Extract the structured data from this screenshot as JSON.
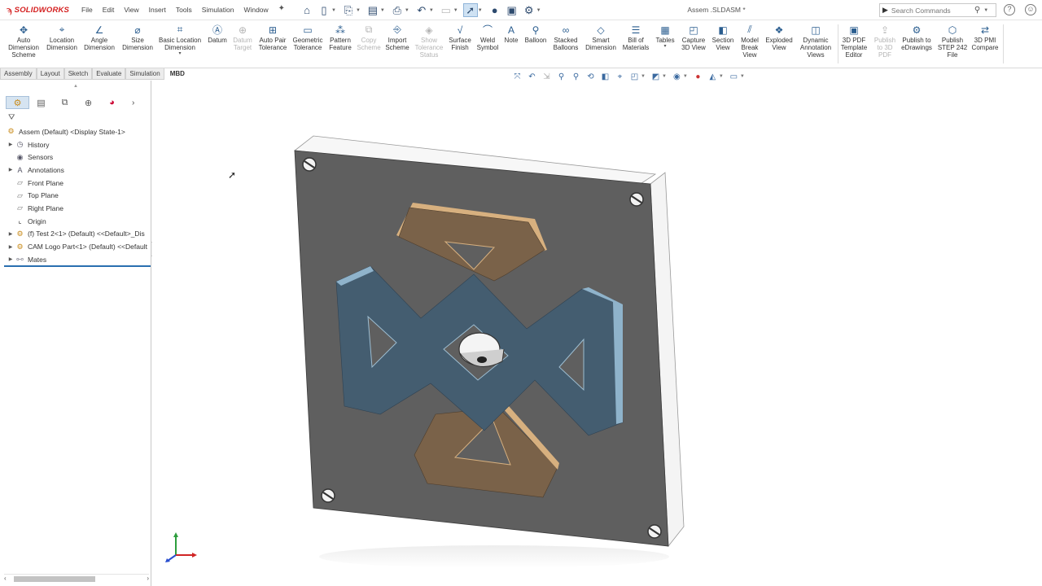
{
  "app": {
    "brand": "SOLIDWORKS",
    "document_title": "Assem .SLDASM *"
  },
  "menus": [
    "File",
    "Edit",
    "View",
    "Insert",
    "Tools",
    "Simulation",
    "Window"
  ],
  "search": {
    "placeholder": "Search Commands"
  },
  "command_manager": [
    {
      "label": "Auto\nDimension\nScheme",
      "icon": "auto-dimension-icon",
      "glyph": "✥",
      "enabled": true
    },
    {
      "label": "Location\nDimension",
      "icon": "location-dimension-icon",
      "glyph": "⌖",
      "enabled": true
    },
    {
      "label": "Angle\nDimension",
      "icon": "angle-dimension-icon",
      "glyph": "∠",
      "enabled": true
    },
    {
      "label": "Size\nDimension",
      "icon": "size-dimension-icon",
      "glyph": "⌀",
      "enabled": true
    },
    {
      "label": "Basic Location\nDimension",
      "icon": "basic-location-dimension-icon",
      "glyph": "⌗",
      "enabled": true,
      "dropdown": true
    },
    {
      "label": "Datum",
      "icon": "datum-icon",
      "glyph": "Ⓐ",
      "enabled": true
    },
    {
      "label": "Datum\nTarget",
      "icon": "datum-target-icon",
      "glyph": "⊕",
      "enabled": false
    },
    {
      "label": "Auto Pair\nTolerance",
      "icon": "auto-pair-tolerance-icon",
      "glyph": "⊞",
      "enabled": true
    },
    {
      "label": "Geometric\nTolerance",
      "icon": "geometric-tolerance-icon",
      "glyph": "▭",
      "enabled": true
    },
    {
      "label": "Pattern\nFeature",
      "icon": "pattern-feature-icon",
      "glyph": "⁂",
      "enabled": true
    },
    {
      "label": "Copy\nScheme",
      "icon": "copy-scheme-icon",
      "glyph": "⧉",
      "enabled": false
    },
    {
      "label": "Import\nScheme",
      "icon": "import-scheme-icon",
      "glyph": "⎆",
      "enabled": true
    },
    {
      "label": "Show\nTolerance\nStatus",
      "icon": "show-tolerance-status-icon",
      "glyph": "◈",
      "enabled": false
    },
    {
      "label": "Surface\nFinish",
      "icon": "surface-finish-icon",
      "glyph": "√",
      "enabled": true
    },
    {
      "label": "Weld\nSymbol",
      "icon": "weld-symbol-icon",
      "glyph": "⌒",
      "enabled": true
    },
    {
      "label": "Note",
      "icon": "note-icon",
      "glyph": "A",
      "enabled": true
    },
    {
      "label": "Balloon",
      "icon": "balloon-icon",
      "glyph": "⚲",
      "enabled": true
    },
    {
      "label": "Stacked\nBalloons",
      "icon": "stacked-balloons-icon",
      "glyph": "∞",
      "enabled": true
    },
    {
      "label": "Smart\nDimension",
      "icon": "smart-dimension-icon",
      "glyph": "◇",
      "enabled": true
    },
    {
      "label": "Bill of\nMaterials",
      "icon": "bill-of-materials-icon",
      "glyph": "☰",
      "enabled": true
    },
    {
      "label": "Tables",
      "icon": "tables-icon",
      "glyph": "▦",
      "enabled": true,
      "dropdown": true
    },
    {
      "label": "Capture\n3D View",
      "icon": "capture-3d-view-icon",
      "glyph": "◰",
      "enabled": true
    },
    {
      "label": "Section\nView",
      "icon": "section-view-icon",
      "glyph": "◧",
      "enabled": true
    },
    {
      "label": "Model\nBreak\nView",
      "icon": "model-break-view-icon",
      "glyph": "⫽",
      "enabled": true
    },
    {
      "label": "Exploded\nView",
      "icon": "exploded-view-icon",
      "glyph": "❖",
      "enabled": true
    },
    {
      "label": "Dynamic\nAnnotation\nViews",
      "icon": "dynamic-annotation-views-icon",
      "glyph": "◫",
      "enabled": true
    },
    {
      "label": "3D PDF\nTemplate\nEditor",
      "icon": "3d-pdf-template-editor-icon",
      "glyph": "▣",
      "enabled": true
    },
    {
      "label": "Publish\nto 3D\nPDF",
      "icon": "publish-3d-pdf-icon",
      "glyph": "⇪",
      "enabled": false
    },
    {
      "label": "Publish to\neDrawings",
      "icon": "publish-edrawings-icon",
      "glyph": "⚙",
      "enabled": true
    },
    {
      "label": "Publish\nSTEP 242\nFile",
      "icon": "publish-step-242-icon",
      "glyph": "⬡",
      "enabled": true
    },
    {
      "label": "3D PMI\nCompare",
      "icon": "3d-pmi-compare-icon",
      "glyph": "⇄",
      "enabled": true
    }
  ],
  "tabs": [
    {
      "label": "Assembly",
      "active": false
    },
    {
      "label": "Layout",
      "active": false
    },
    {
      "label": "Sketch",
      "active": false
    },
    {
      "label": "Evaluate",
      "active": false
    },
    {
      "label": "Simulation",
      "active": false
    },
    {
      "label": "MBD",
      "active": true
    }
  ],
  "tree": {
    "root": "Assem  (Default) <Display State-1>",
    "items": [
      {
        "label": "History",
        "icon": "history-icon",
        "expandable": true
      },
      {
        "label": "Sensors",
        "icon": "sensors-icon",
        "expandable": false
      },
      {
        "label": "Annotations",
        "icon": "annotations-icon",
        "expandable": true
      },
      {
        "label": "Front Plane",
        "icon": "plane-icon",
        "expandable": false
      },
      {
        "label": "Top Plane",
        "icon": "plane-icon",
        "expandable": false
      },
      {
        "label": "Right Plane",
        "icon": "plane-icon",
        "expandable": false
      },
      {
        "label": "Origin",
        "icon": "origin-icon",
        "expandable": false
      },
      {
        "label": "(f) Test 2<1> (Default) <<Default>_Dis",
        "icon": "part-icon",
        "expandable": true
      },
      {
        "label": "CAM Logo Part<1> (Default) <<Default",
        "icon": "part-icon",
        "expandable": true
      },
      {
        "label": "Mates",
        "icon": "mates-icon",
        "expandable": true
      }
    ]
  },
  "colors": {
    "brand_red": "#d41e1e",
    "plate_face": "#5f5f5f",
    "plate_edge": "#f6f6f6",
    "logo_blue": "#445d70",
    "logo_brown": "#7a6249",
    "tree_divider": "#2a6fb0"
  }
}
